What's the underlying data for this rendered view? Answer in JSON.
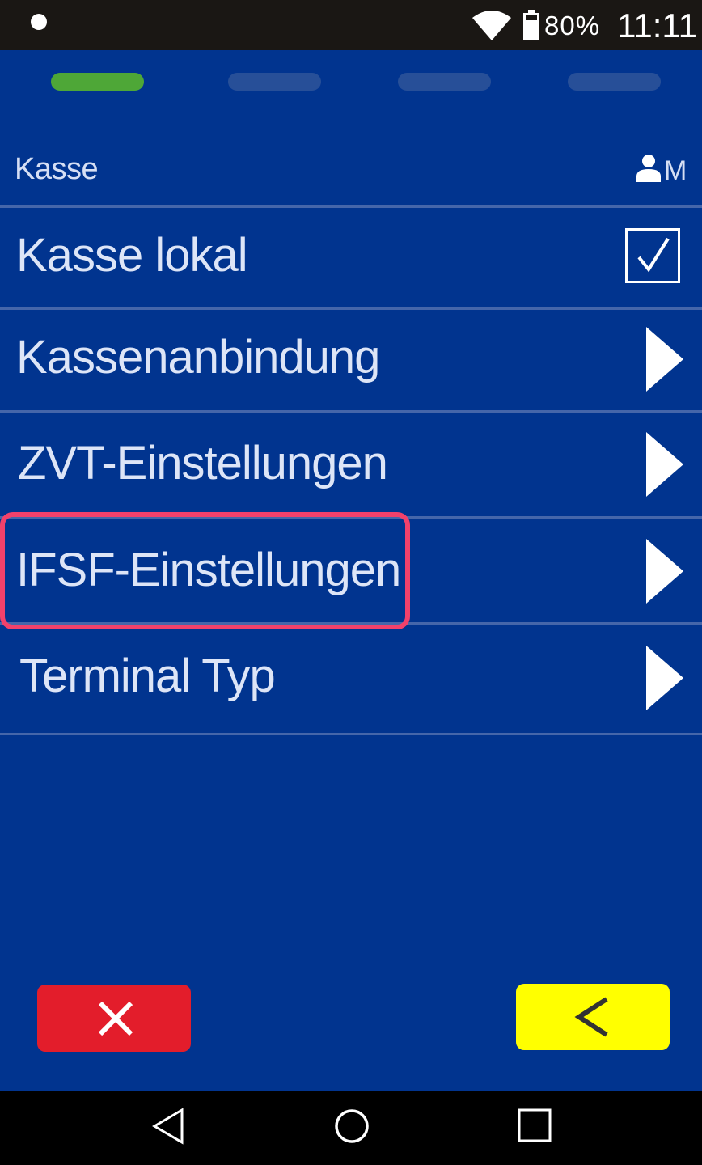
{
  "status_bar": {
    "battery_level": "80%",
    "time": "11:11"
  },
  "progress": {
    "total_steps": 4,
    "current_step": 1
  },
  "header": {
    "title": "Kasse",
    "user_level": "M"
  },
  "menu": {
    "items": [
      {
        "label": "Kasse lokal",
        "control": "checkbox",
        "checked": true
      },
      {
        "label": "Kassenanbindung",
        "control": "arrow"
      },
      {
        "label": "ZVT-Einstellungen",
        "control": "arrow"
      },
      {
        "label": "IFSF-Einstellungen",
        "control": "arrow",
        "highlighted": true
      },
      {
        "label": "Terminal Typ",
        "control": "arrow"
      }
    ]
  },
  "actions": {
    "cancel_icon": "close-icon",
    "back_icon": "chevron-left-icon"
  },
  "colors": {
    "background": "#01348f",
    "step_active": "#4ea737",
    "step_inactive": "#274f98",
    "cancel": "#e31d2b",
    "back": "#ffff00",
    "highlight": "#f2416b"
  }
}
